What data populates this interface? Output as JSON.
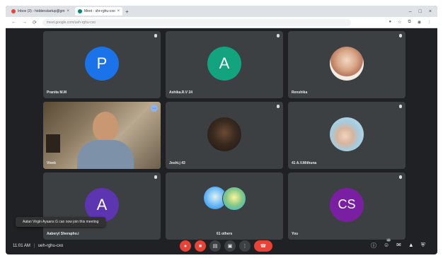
{
  "browser": {
    "tabs": [
      {
        "title": "Inbox (3) - hiddenstartup@gm",
        "favicon_color": "#ea4335",
        "active": false
      },
      {
        "title": "Meet - shr-rghu-cxo",
        "favicon_color": "#ea4335",
        "active": true
      }
    ],
    "url": "meet.google.com/ueh-rghu-cxo",
    "new_tab_label": "+"
  },
  "meeting": {
    "time": "11:01 AM",
    "code": "ueh-rghu-cxo",
    "toast": "Aalan Virgin Ayaans G can now join this meeting",
    "participant_count": "43"
  },
  "tiles": [
    {
      "name": "Pranita M.M",
      "type": "initial",
      "initial": "P",
      "color": "#1a73e8"
    },
    {
      "name": "Ashika.R.V 24",
      "type": "initial",
      "initial": "A",
      "color": "#12a37f"
    },
    {
      "name": "Renshika",
      "type": "photo"
    },
    {
      "name": "Vivek",
      "type": "camera"
    },
    {
      "name": "Joshi.j 43",
      "type": "photo"
    },
    {
      "name": "41 A.V.Mithuna",
      "type": "photo"
    },
    {
      "name": "Aaberyl Sherapho.i",
      "type": "initial",
      "initial": "A",
      "color": "#5e35b1"
    },
    {
      "name": "61 others",
      "type": "group"
    },
    {
      "name": "You",
      "type": "initial",
      "initial": "CS",
      "color": "#7b1fa2"
    }
  ],
  "colors": {
    "background": "#202124",
    "tile": "#3c4043",
    "end_call": "#ea4335",
    "accent": "#8ab4f8"
  },
  "icons": {
    "controls": [
      "mic-off-icon",
      "camera-off-icon",
      "captions-icon",
      "present-icon",
      "more-icon",
      "end-call-icon"
    ],
    "right": [
      "info-icon",
      "people-icon",
      "chat-icon",
      "activities-icon",
      "host-controls-icon"
    ]
  }
}
